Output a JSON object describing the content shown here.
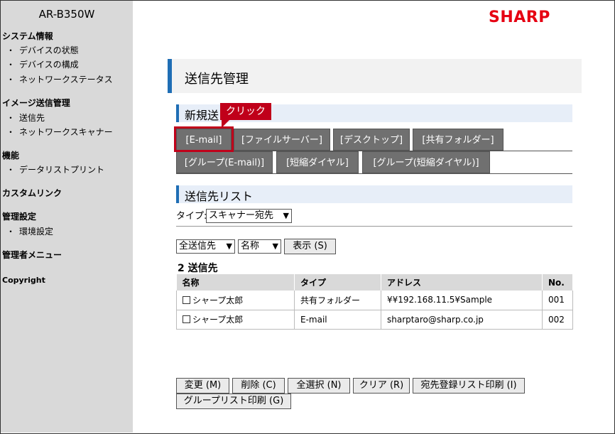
{
  "sidebar": {
    "model": "AR-B350W",
    "sections": [
      {
        "title": "システム情報",
        "items": [
          "デバイスの状態",
          "デバイスの構成",
          "ネットワークステータス"
        ]
      },
      {
        "title": "イメージ送信管理",
        "items": [
          "送信先",
          "ネットワークスキャナー"
        ]
      },
      {
        "title": "機能",
        "items": [
          "データリストプリント"
        ]
      },
      {
        "title": "カスタムリンク",
        "items": []
      },
      {
        "title": "管理設定",
        "items": [
          "環境設定"
        ]
      },
      {
        "title": "管理者メニュー",
        "items": []
      },
      {
        "title": "Copyright",
        "items": []
      }
    ],
    "bullet": "・"
  },
  "logo": "SHARP",
  "page_title": "送信先管理",
  "new_reg": {
    "heading": "新規送",
    "callout": "クリック",
    "tabs_row1": [
      "[E-mail]",
      "[ファイルサーバー]",
      "[デスクトップ]",
      "[共有フォルダー]"
    ],
    "tabs_row2": [
      "[グループ(E-mail)]",
      "[短縮ダイヤル]",
      "[グループ(短縮ダイヤル)]"
    ]
  },
  "dest_list": {
    "heading": "送信先リスト",
    "type_label": "タイプ:",
    "type_value": "スキャナー宛先",
    "filter_value": "全送信先",
    "sort_value": "名称",
    "show_button": "表示 (S)",
    "count": "2 送信先",
    "columns": [
      "名称",
      "タイプ",
      "アドレス",
      "No."
    ],
    "rows": [
      {
        "name": "シャープ太郎",
        "type": "共有フォルダー",
        "address": "¥¥192.168.11.5¥Sample",
        "no": "001"
      },
      {
        "name": "シャープ太郎",
        "type": "E-mail",
        "address": "sharptaro@sharp.co.jp",
        "no": "002"
      }
    ]
  },
  "buttons": {
    "change": "変更 (M)",
    "delete": "削除 (C)",
    "select_all": "全選択 (N)",
    "clear": "クリア (R)",
    "print_list": "宛先登録リスト印刷 (I)",
    "print_group": "グループリスト印刷 (G)"
  },
  "colors": {
    "accent": "#1f6eb5",
    "brand": "#e60012",
    "callout": "#c0001a",
    "tab": "#707070"
  }
}
